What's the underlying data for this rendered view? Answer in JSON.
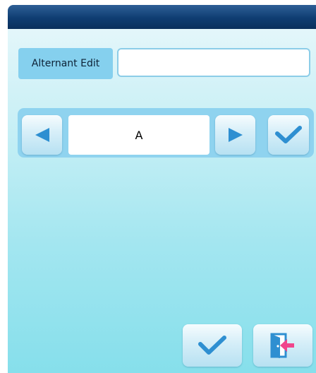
{
  "window": {
    "accent_color": "#0f3d72"
  },
  "edit_row": {
    "label": "Alternant Edit",
    "value": ""
  },
  "selector": {
    "current_value": "A",
    "prev_icon": "triangle-left-icon",
    "next_icon": "triangle-right-icon",
    "confirm_icon": "checkmark-icon"
  },
  "footer": {
    "ok_icon": "checkmark-icon",
    "exit_icon": "exit-door-icon"
  }
}
